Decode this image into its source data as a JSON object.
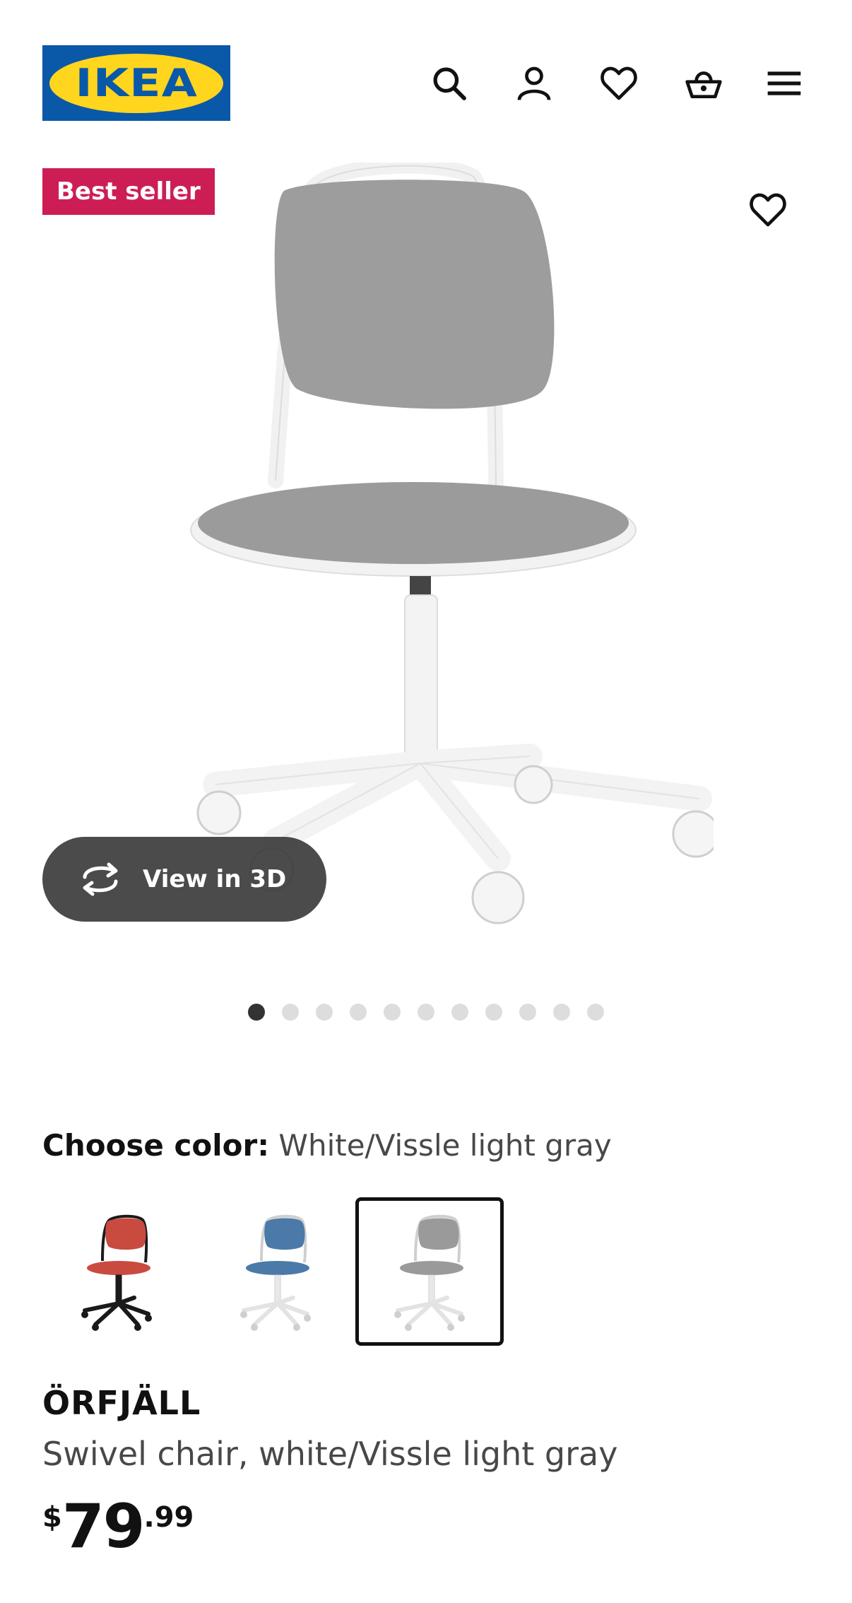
{
  "header": {
    "logo_text": "IKEA",
    "icons": [
      "search-icon",
      "account-icon",
      "heart-icon",
      "basket-icon",
      "menu-icon"
    ]
  },
  "hero": {
    "badge": "Best seller",
    "view3d_label": "View in 3D",
    "carousel": {
      "total": 11,
      "active": 1
    }
  },
  "product": {
    "color_label": "Choose color:",
    "color_value": "White/Vissle light gray",
    "swatches": [
      {
        "name": "Red/black",
        "cushion": "#c94a3f",
        "frame": "#1a1a1a",
        "selected": false
      },
      {
        "name": "Blue/white",
        "cushion": "#4b7aa8",
        "frame": "#eeeeee",
        "selected": false
      },
      {
        "name": "White/Vissle light gray",
        "cushion": "#9a9a9a",
        "frame": "#eeeeee",
        "selected": true
      }
    ],
    "name": "ÖRFJÄLL",
    "description": "Swivel chair, white/Vissle light gray",
    "price": {
      "currency": "$",
      "integer": "79",
      "decimal": ".99"
    }
  },
  "colors": {
    "brand_blue": "#0a58a8",
    "brand_yellow": "#ffd51e",
    "badge_red": "#cc1e55",
    "cushion_gray": "#9d9d9d"
  }
}
